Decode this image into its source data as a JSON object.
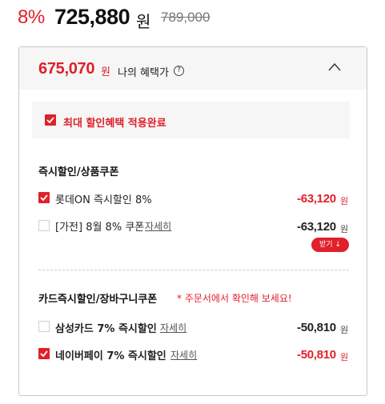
{
  "header": {
    "discount_rate": "8%",
    "sale_price": "725,880",
    "won": "원",
    "original_price": "789,000"
  },
  "benefit": {
    "amount": "675,070",
    "won": "원",
    "label": "나의 혜택가",
    "help": "?"
  },
  "max_benefit": {
    "label": "최대 할인혜택 적용완료",
    "checked": true
  },
  "instant_section": {
    "title": "즉시할인/상품쿠폰",
    "items": [
      {
        "label": "롯데ON 즉시할인 8%",
        "link": "",
        "amount": "-63,120",
        "won": "원",
        "checked": true
      },
      {
        "label": "[가전] 8월 8% 쿠폰",
        "link": "자세히",
        "amount": "-63,120",
        "won": "원",
        "checked": false,
        "button": "받기 ↓"
      }
    ]
  },
  "card_section": {
    "title": "카드즉시할인/장바구니쿠폰",
    "note": "* 주문서에서 확인해 보세요!",
    "items": [
      {
        "label": "삼성카드 7% 즉시할인",
        "link": "자세히",
        "amount": "-50,810",
        "won": "원",
        "checked": false
      },
      {
        "label": "네이버페이 7% 즉시할인",
        "link": "자세히",
        "amount": "-50,810",
        "won": "원",
        "checked": true
      }
    ]
  },
  "colors": {
    "accent": "#e0202a",
    "panel_bg": "#f6f6f6",
    "border": "#c8c8c8"
  },
  "icons": {
    "help": "question-circle-icon",
    "collapse": "chevron-up-icon",
    "check": "check-icon",
    "download": "download-arrow-icon"
  }
}
